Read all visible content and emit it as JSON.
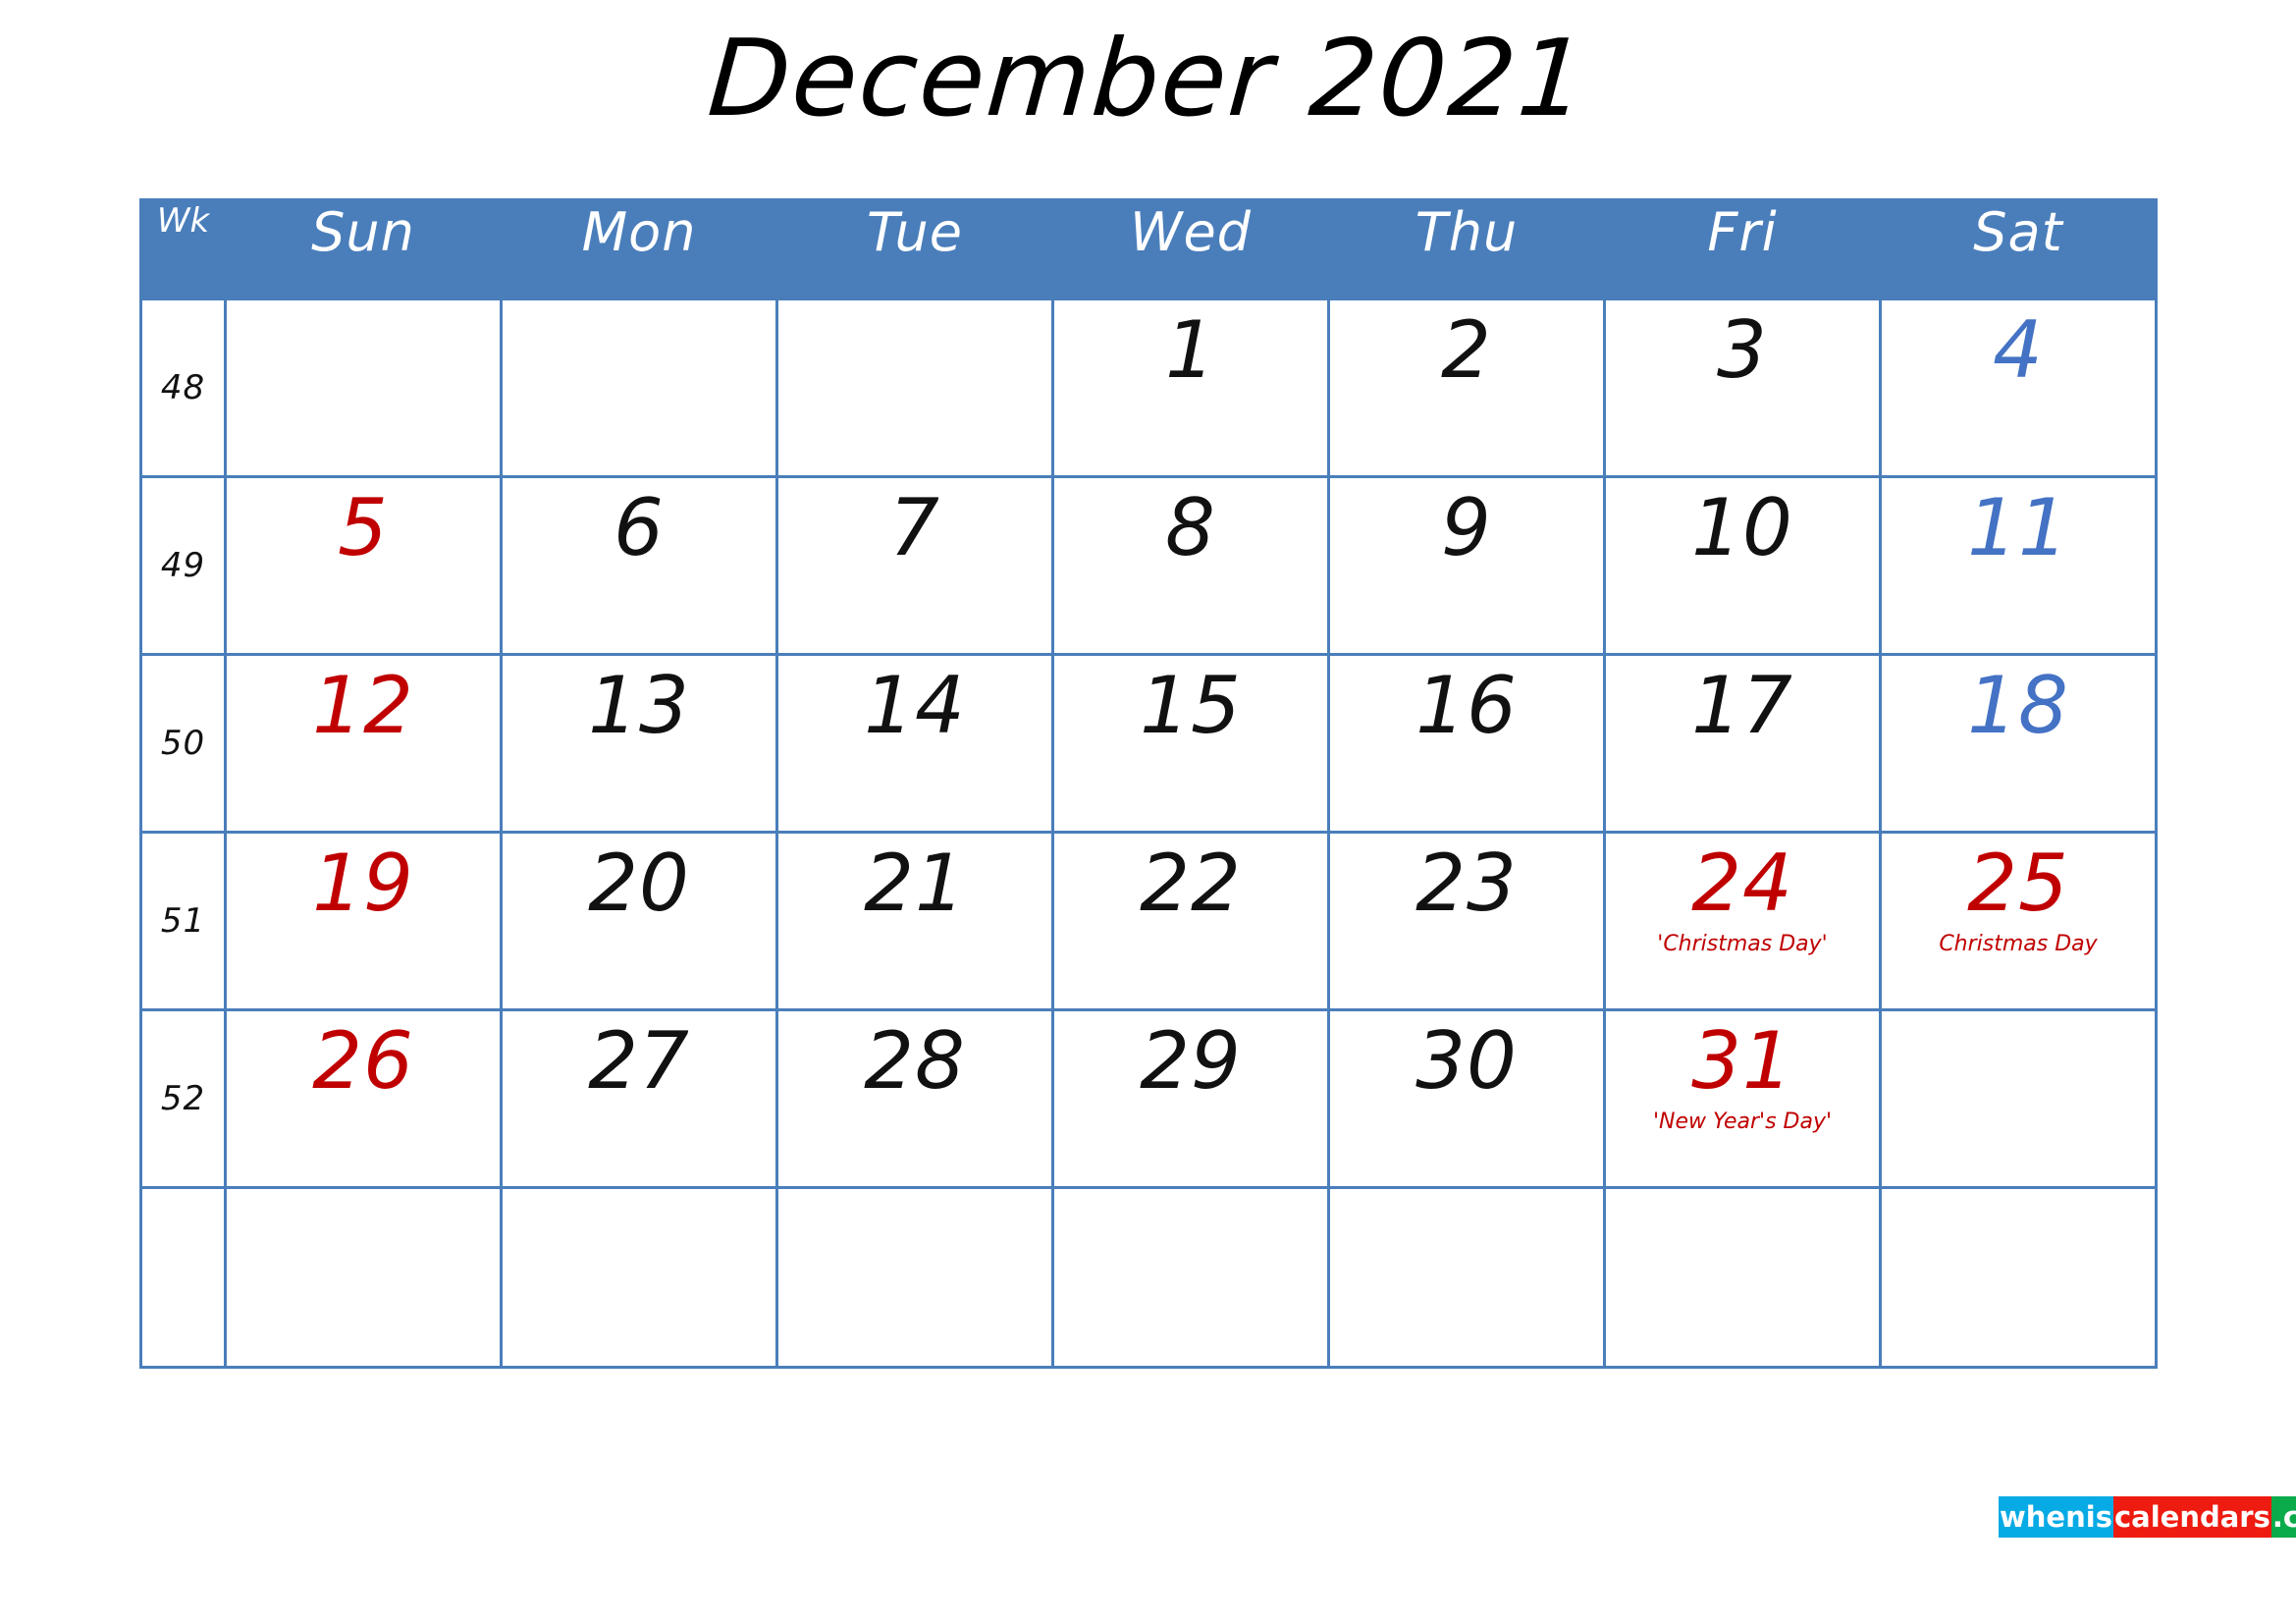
{
  "title": "December 2021",
  "colors": {
    "header_blue": "#4a7ebb",
    "grid_blue": "#4a7ebb",
    "sunday_red": "#c00000",
    "saturday_blue": "#4472c4",
    "holiday_red": "#c00000",
    "logo_cyan": "#06aae4",
    "logo_red": "#ee1b11",
    "logo_green": "#0bab4c"
  },
  "header": {
    "wk": "Wk",
    "days": [
      "Sun",
      "Mon",
      "Tue",
      "Wed",
      "Thu",
      "Fri",
      "Sat"
    ]
  },
  "weeks": [
    {
      "wk": "48",
      "days": [
        {
          "num": "",
          "kind": "empty",
          "holiday": ""
        },
        {
          "num": "",
          "kind": "empty",
          "holiday": ""
        },
        {
          "num": "",
          "kind": "empty",
          "holiday": ""
        },
        {
          "num": "1",
          "kind": "weekday",
          "holiday": ""
        },
        {
          "num": "2",
          "kind": "weekday",
          "holiday": ""
        },
        {
          "num": "3",
          "kind": "weekday",
          "holiday": ""
        },
        {
          "num": "4",
          "kind": "sat",
          "holiday": ""
        }
      ]
    },
    {
      "wk": "49",
      "days": [
        {
          "num": "5",
          "kind": "sun",
          "holiday": ""
        },
        {
          "num": "6",
          "kind": "weekday",
          "holiday": ""
        },
        {
          "num": "7",
          "kind": "weekday",
          "holiday": ""
        },
        {
          "num": "8",
          "kind": "weekday",
          "holiday": ""
        },
        {
          "num": "9",
          "kind": "weekday",
          "holiday": ""
        },
        {
          "num": "10",
          "kind": "weekday",
          "holiday": ""
        },
        {
          "num": "11",
          "kind": "sat",
          "holiday": ""
        }
      ]
    },
    {
      "wk": "50",
      "days": [
        {
          "num": "12",
          "kind": "sun",
          "holiday": ""
        },
        {
          "num": "13",
          "kind": "weekday",
          "holiday": ""
        },
        {
          "num": "14",
          "kind": "weekday",
          "holiday": ""
        },
        {
          "num": "15",
          "kind": "weekday",
          "holiday": ""
        },
        {
          "num": "16",
          "kind": "weekday",
          "holiday": ""
        },
        {
          "num": "17",
          "kind": "weekday",
          "holiday": ""
        },
        {
          "num": "18",
          "kind": "sat",
          "holiday": ""
        }
      ]
    },
    {
      "wk": "51",
      "days": [
        {
          "num": "19",
          "kind": "sun",
          "holiday": ""
        },
        {
          "num": "20",
          "kind": "weekday",
          "holiday": ""
        },
        {
          "num": "21",
          "kind": "weekday",
          "holiday": ""
        },
        {
          "num": "22",
          "kind": "weekday",
          "holiday": ""
        },
        {
          "num": "23",
          "kind": "weekday",
          "holiday": ""
        },
        {
          "num": "24",
          "kind": "holiday",
          "holiday": "'Christmas Day'"
        },
        {
          "num": "25",
          "kind": "holiday",
          "holiday": "Christmas Day"
        }
      ]
    },
    {
      "wk": "52",
      "days": [
        {
          "num": "26",
          "kind": "sun",
          "holiday": ""
        },
        {
          "num": "27",
          "kind": "weekday",
          "holiday": ""
        },
        {
          "num": "28",
          "kind": "weekday",
          "holiday": ""
        },
        {
          "num": "29",
          "kind": "weekday",
          "holiday": ""
        },
        {
          "num": "30",
          "kind": "weekday",
          "holiday": ""
        },
        {
          "num": "31",
          "kind": "holiday",
          "holiday": "'New Year's Day'"
        },
        {
          "num": "",
          "kind": "empty",
          "holiday": ""
        }
      ]
    },
    {
      "wk": "",
      "days": [
        {
          "num": "",
          "kind": "empty",
          "holiday": ""
        },
        {
          "num": "",
          "kind": "empty",
          "holiday": ""
        },
        {
          "num": "",
          "kind": "empty",
          "holiday": ""
        },
        {
          "num": "",
          "kind": "empty",
          "holiday": ""
        },
        {
          "num": "",
          "kind": "empty",
          "holiday": ""
        },
        {
          "num": "",
          "kind": "empty",
          "holiday": ""
        },
        {
          "num": "",
          "kind": "empty",
          "holiday": ""
        }
      ]
    }
  ],
  "logo": {
    "part1": "whenis",
    "part2": "calendars",
    "part3": ".com"
  }
}
